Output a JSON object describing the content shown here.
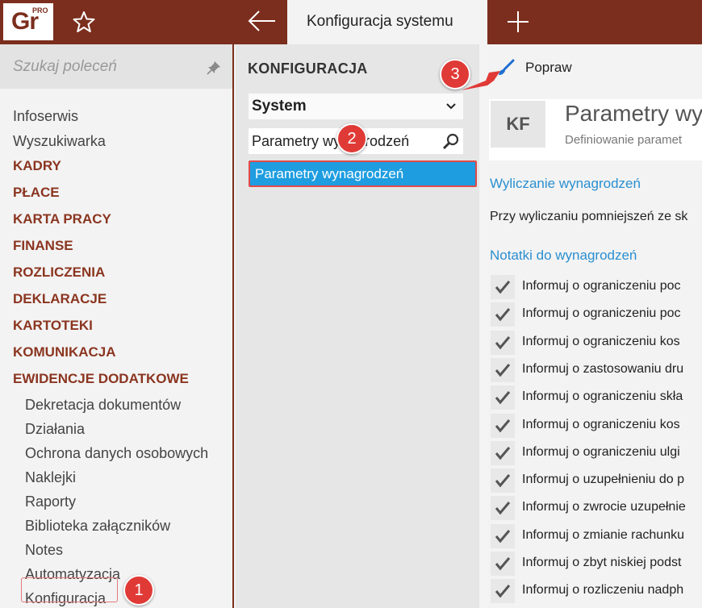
{
  "topbar": {
    "logo_text": "Gr",
    "logo_badge": "PRO",
    "active_tab": "Konfiguracja systemu"
  },
  "sidebar": {
    "search_placeholder": "Szukaj poleceń",
    "items": [
      {
        "label": "Infoserwis",
        "kind": "item"
      },
      {
        "label": "Wyszukiwarka",
        "kind": "item"
      },
      {
        "label": "KADRY",
        "kind": "section"
      },
      {
        "label": "PŁACE",
        "kind": "section"
      },
      {
        "label": "KARTA PRACY",
        "kind": "section"
      },
      {
        "label": "FINANSE",
        "kind": "section"
      },
      {
        "label": "ROZLICZENIA",
        "kind": "section"
      },
      {
        "label": "DEKLARACJE",
        "kind": "section"
      },
      {
        "label": "KARTOTEKI",
        "kind": "section"
      },
      {
        "label": "KOMUNIKACJA",
        "kind": "section"
      },
      {
        "label": "EWIDENCJE DODATKOWE",
        "kind": "section"
      },
      {
        "label": "Dekretacja dokumentów",
        "kind": "sub"
      },
      {
        "label": "Działania",
        "kind": "sub"
      },
      {
        "label": "Ochrona danych osobowych",
        "kind": "sub"
      },
      {
        "label": "Naklejki",
        "kind": "sub"
      },
      {
        "label": "Raporty",
        "kind": "sub"
      },
      {
        "label": "Biblioteka załączników",
        "kind": "sub"
      },
      {
        "label": "Notes",
        "kind": "sub"
      },
      {
        "label": "Automatyzacja",
        "kind": "sub"
      },
      {
        "label": "Konfiguracja",
        "kind": "sub"
      }
    ]
  },
  "middle": {
    "title": "KONFIGURACJA",
    "dropdown_value": "System",
    "search_value": "Parametry wynagrodzeń",
    "selected_item": "Parametry wynagrodzeń"
  },
  "content": {
    "action_label": "Popraw",
    "badge": "KF",
    "title": "Parametry wy",
    "subtitle": "Definiowanie paramet",
    "section1": "Wyliczanie wynagrodzeń",
    "text1": "Przy wyliczaniu pomniejszeń ze sk",
    "section2": "Notatki do wynagrodzeń",
    "checks": [
      "Informuj o ograniczeniu poc",
      "Informuj o ograniczeniu poc",
      "Informuj o ograniczeniu kos",
      "Informuj o zastosowaniu dru",
      "Informuj o ograniczeniu skła",
      "Informuj o ograniczeniu kos",
      "Informuj o ograniczeniu ulgi",
      "Informuj o uzupełnieniu do p",
      "Informuj o zwrocie uzupełnie",
      "Informuj o zmianie rachunku",
      "Informuj o zbyt niskiej podst",
      "Informuj o rozliczeniu nadph"
    ]
  },
  "callouts": [
    "1",
    "2",
    "3"
  ],
  "colors": {
    "brand": "#7b2e1d",
    "section_text": "#8b3520",
    "link": "#2a8fd0",
    "selection": "#1e9de0",
    "callout": "#e03a36"
  }
}
